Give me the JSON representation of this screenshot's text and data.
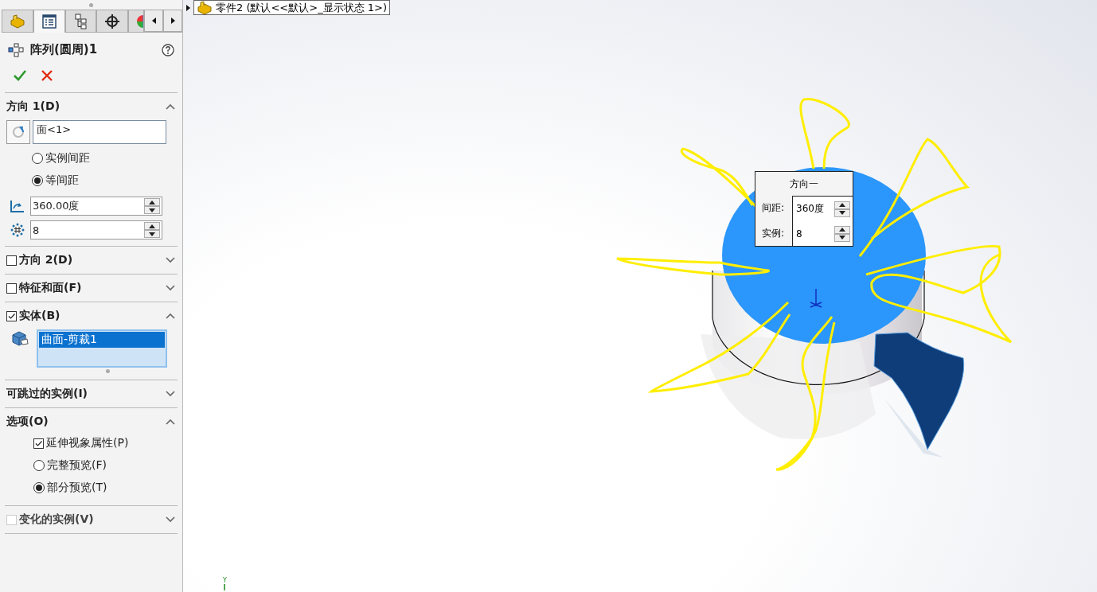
{
  "panel": {
    "tabs": [
      {
        "kind": "part",
        "selected": false
      },
      {
        "kind": "properties",
        "selected": true
      },
      {
        "kind": "config",
        "selected": false
      },
      {
        "kind": "target",
        "selected": false
      },
      {
        "kind": "appearance",
        "selected": false
      }
    ],
    "feature": {
      "title": "阵列(圆周)1"
    },
    "sections": [
      {
        "kind": "direction",
        "title": "方向 1(D)",
        "expanded": true,
        "reference": "面<1>",
        "spacing": [
          {
            "label": "实例间距",
            "selected": false
          },
          {
            "label": "等间距",
            "selected": true
          }
        ],
        "angle": "360.00度",
        "count": "8"
      },
      {
        "title": "方向 2(D)",
        "expanded": false,
        "checkbox": {
          "checked": false,
          "disabled": false
        }
      },
      {
        "title": "特征和面(F)",
        "expanded": false,
        "checkbox": {
          "checked": false,
          "disabled": false
        }
      },
      {
        "kind": "bodies",
        "title": "实体(B)",
        "expanded": true,
        "checkbox": {
          "checked": true,
          "disabled": false
        },
        "items": [
          {
            "label": "曲面-剪裁1",
            "selected": true
          }
        ]
      },
      {
        "title": "可跳过的实例(I)",
        "expanded": false
      },
      {
        "kind": "options",
        "title": "选项(O)",
        "expanded": true,
        "options": [
          {
            "kind": "checkbox",
            "label": "延伸视象属性(P)",
            "checked": true
          },
          {
            "kind": "radio",
            "label": "完整预览(F)",
            "selected": false
          },
          {
            "kind": "radio",
            "label": "部分预览(T)",
            "selected": true
          }
        ]
      },
      {
        "title": "变化的实例(V)",
        "expanded": false,
        "checkbox": {
          "checked": false,
          "disabled": true
        }
      }
    ]
  },
  "viewport": {
    "tree_item": "零件2  (默认<<默认>_显示状态 1>)",
    "callout": {
      "title": "方向一",
      "rows": [
        {
          "label": "间距:",
          "value": "360度"
        },
        {
          "label": "实例:",
          "value": "8"
        }
      ]
    },
    "axis_label": "Y"
  }
}
